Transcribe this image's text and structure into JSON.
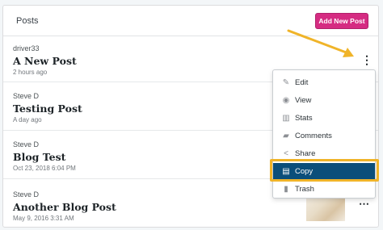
{
  "header": {
    "title": "Posts",
    "add_label": "Add New Post"
  },
  "posts": [
    {
      "author": "driver33",
      "title": "A New Post",
      "date": "2 hours ago"
    },
    {
      "author": "Steve D",
      "title": "Testing Post",
      "date": "A day ago"
    },
    {
      "author": "Steve D",
      "title": "Blog Test",
      "date": "Oct 23, 2018 6:04 PM"
    },
    {
      "author": "Steve D",
      "title": "Another Blog Post",
      "date": "May 9, 2016 3:31 AM"
    }
  ],
  "menu": {
    "items": [
      {
        "label": "Edit",
        "icon": "pencil-icon"
      },
      {
        "label": "View",
        "icon": "eye-icon"
      },
      {
        "label": "Stats",
        "icon": "stats-icon"
      },
      {
        "label": "Comments",
        "icon": "comments-icon"
      },
      {
        "label": "Share",
        "icon": "share-icon"
      },
      {
        "label": "Copy",
        "icon": "clipboard-icon"
      },
      {
        "label": "Trash",
        "icon": "trash-icon"
      }
    ],
    "active": "Copy"
  },
  "colors": {
    "accent": "#d52c82",
    "menu_active": "#0b4e7a",
    "highlight": "#f0b429"
  }
}
